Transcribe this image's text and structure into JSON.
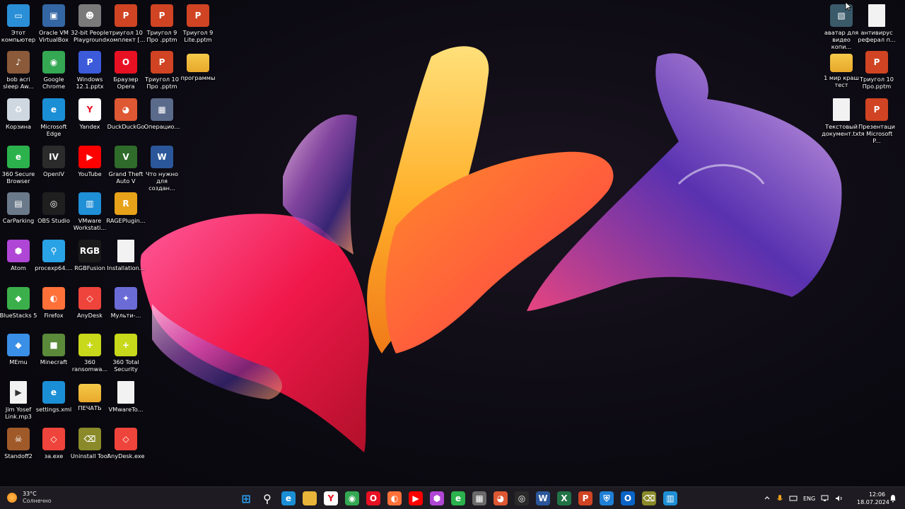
{
  "desktop": {
    "icons_left": [
      {
        "label": "Этот компьютер",
        "icon": "monitor-icon",
        "color": "#2a8fd6"
      },
      {
        "label": "Oracle VM VirtualBox",
        "icon": "virtualbox-icon",
        "color": "#3466a3"
      },
      {
        "label": "32-bit People Playground",
        "icon": "people-playground-icon",
        "color": "#7a7a7a"
      },
      {
        "label": "триугол 10 комплект [...",
        "icon": "powerpoint-file-icon",
        "color": "#d04423"
      },
      {
        "label": "Триугол 9 Про .pptm",
        "icon": "powerpoint-file-icon",
        "color": "#d04423"
      },
      {
        "label": "Триугол 9 Lite.pptm",
        "icon": "powerpoint-file-icon",
        "color": "#d04423"
      },
      {
        "label": "bob acri sleep Aw...",
        "icon": "album-cover-icon",
        "color": "#8a5a3a"
      },
      {
        "label": "Google Chrome",
        "icon": "chrome-icon",
        "color": "#34a853"
      },
      {
        "label": "Windows 12.1.pptx",
        "icon": "powerpoint-file-icon",
        "color": "#3b5bdb"
      },
      {
        "label": "Браузер Opera",
        "icon": "opera-icon",
        "color": "#e81123"
      },
      {
        "label": "Триугол 10 Про .pptm",
        "icon": "powerpoint-file-icon",
        "color": "#d04423"
      },
      {
        "label": "программы",
        "icon": "folder-icon",
        "color": "#e8b43a"
      },
      {
        "label": "Корзина",
        "icon": "recycle-bin-icon",
        "color": "#cfd8e0"
      },
      {
        "label": "Microsoft Edge",
        "icon": "edge-icon",
        "color": "#1b8fd6"
      },
      {
        "label": "Yandex",
        "icon": "yandex-icon",
        "color": "#ffffff"
      },
      {
        "label": "DuckDuckGo",
        "icon": "duckduckgo-icon",
        "color": "#de5833"
      },
      {
        "label": "Операцио...",
        "icon": "game-thumbnail-icon",
        "color": "#5a6a8a"
      },
      {
        "label": "360 Secure Browser",
        "icon": "360-browser-icon",
        "color": "#2bb24c"
      },
      {
        "label": "OpenIV",
        "icon": "openiv-icon",
        "color": "#2b2b2b"
      },
      {
        "label": "YouTube",
        "icon": "youtube-icon",
        "color": "#ff0000"
      },
      {
        "label": "Grand Theft Auto V",
        "icon": "gta-icon",
        "color": "#2f6b2a"
      },
      {
        "label": "Что нужно для создан...",
        "icon": "word-file-icon",
        "color": "#2b579a"
      },
      {
        "label": "CarParking",
        "icon": "carparking-icon",
        "color": "#6b7a8a"
      },
      {
        "label": "OBS Studio",
        "icon": "obs-icon",
        "color": "#1f1f1f"
      },
      {
        "label": "VMware Workstati...",
        "icon": "vmware-icon",
        "color": "#1f8fd6"
      },
      {
        "label": "RAGEPlugin...",
        "icon": "rage-icon",
        "color": "#e8a21a"
      },
      {
        "label": "Atom",
        "icon": "atom-icon",
        "color": "#b046d6"
      },
      {
        "label": "procexp64....",
        "icon": "process-explorer-icon",
        "color": "#2aa2e6"
      },
      {
        "label": "RGBFusion",
        "icon": "rgbfusion-icon",
        "color": "#1a1a1a"
      },
      {
        "label": "Installation...",
        "icon": "text-file-icon",
        "color": "#e6e6e6"
      },
      {
        "label": "BlueStacks 5",
        "icon": "bluestacks-icon",
        "color": "#3bb04a"
      },
      {
        "label": "Firefox",
        "icon": "firefox-icon",
        "color": "#ff7139"
      },
      {
        "label": "AnyDesk",
        "icon": "anydesk-icon",
        "color": "#ef443b"
      },
      {
        "label": "Мульти-...",
        "icon": "multi-app-icon",
        "color": "#6b6bd6"
      },
      {
        "label": "MEmu",
        "icon": "memu-icon",
        "color": "#3a8fe6"
      },
      {
        "label": "Minecraft",
        "icon": "minecraft-icon",
        "color": "#5a8a3a"
      },
      {
        "label": "360 ransomwa...",
        "icon": "360-ransomware-icon",
        "color": "#c8d81a"
      },
      {
        "label": "360 Total Security",
        "icon": "360-total-security-icon",
        "color": "#c8d81a"
      },
      {
        "label": "Jim Yosef Link.mp3",
        "icon": "audio-file-icon",
        "color": "#e6e6e6"
      },
      {
        "label": "settings.xml",
        "icon": "edge-file-icon",
        "color": "#1b8fd6"
      },
      {
        "label": "ПЕЧАТЬ",
        "icon": "folder-icon",
        "color": "#e8b43a"
      },
      {
        "label": "VMwareTo...",
        "icon": "text-file-icon",
        "color": "#e6e6e6"
      },
      {
        "label": "Standoff2",
        "icon": "standoff-icon",
        "color": "#a05a2a"
      },
      {
        "label": "за.exe",
        "icon": "anydesk-icon",
        "color": "#ef443b"
      },
      {
        "label": "Uninstall Tool",
        "icon": "uninstall-tool-icon",
        "color": "#8a8a2a"
      },
      {
        "label": "AnyDesk.exe",
        "icon": "anydesk-icon",
        "color": "#ef443b"
      }
    ],
    "icons_right": [
      {
        "label": "аватар для видео копи...",
        "icon": "image-thumbnail-icon",
        "color": "#3a5a6a"
      },
      {
        "label": "антивирус реферал п...",
        "icon": "text-file-icon",
        "color": "#e6e6e6"
      },
      {
        "label": "1 мир краш тест",
        "icon": "folder-icon",
        "color": "#e8b43a"
      },
      {
        "label": "Триугол 10 Про.pptm",
        "icon": "powerpoint-file-icon",
        "color": "#d04423"
      },
      {
        "label": "Текстовый документ.txt",
        "icon": "text-file-icon",
        "color": "#e6e6e6"
      },
      {
        "label": "Презентация Microsoft P...",
        "icon": "powerpoint-file-icon",
        "color": "#d04423"
      }
    ]
  },
  "taskbar": {
    "weather": {
      "temperature": "33°C",
      "condition": "Солнечно"
    },
    "pinned": [
      {
        "name": "start-button",
        "icon": "windows-start-icon",
        "color": "#2a9ff0"
      },
      {
        "name": "search-button",
        "icon": "search-icon",
        "color": "#ffffff"
      },
      {
        "name": "edge-taskbar",
        "icon": "edge-icon",
        "color": "#1b8fd6"
      },
      {
        "name": "explorer-taskbar",
        "icon": "folder-icon",
        "color": "#e8b43a"
      },
      {
        "name": "yandex-taskbar",
        "icon": "yandex-icon",
        "color": "#ffffff"
      },
      {
        "name": "chrome-taskbar",
        "icon": "chrome-icon",
        "color": "#34a853"
      },
      {
        "name": "opera-taskbar",
        "icon": "opera-icon",
        "color": "#e81123"
      },
      {
        "name": "firefox-taskbar",
        "icon": "firefox-icon",
        "color": "#ff7139"
      },
      {
        "name": "youtube-taskbar",
        "icon": "youtube-icon",
        "color": "#ff0000"
      },
      {
        "name": "atom-taskbar",
        "icon": "atom-icon",
        "color": "#b046d6"
      },
      {
        "name": "360-taskbar",
        "icon": "360-browser-icon",
        "color": "#2bb24c"
      },
      {
        "name": "calculator-taskbar",
        "icon": "calculator-icon",
        "color": "#6a6a6a"
      },
      {
        "name": "duckduckgo-taskbar",
        "icon": "duckduckgo-icon",
        "color": "#de5833"
      },
      {
        "name": "obs-taskbar",
        "icon": "obs-icon",
        "color": "#2a2a2a"
      },
      {
        "name": "word-taskbar",
        "icon": "word-icon",
        "color": "#2b579a"
      },
      {
        "name": "excel-taskbar",
        "icon": "excel-icon",
        "color": "#217346"
      },
      {
        "name": "powerpoint-taskbar",
        "icon": "powerpoint-icon",
        "color": "#d04423"
      },
      {
        "name": "defender-taskbar",
        "icon": "shield-icon",
        "color": "#1f7fd6"
      },
      {
        "name": "outlook-taskbar",
        "icon": "outlook-icon",
        "color": "#0a64c8"
      },
      {
        "name": "uninstall-taskbar",
        "icon": "uninstall-tool-icon",
        "color": "#8a8a2a"
      },
      {
        "name": "vmware-taskbar",
        "icon": "vmware-icon",
        "color": "#1f8fd6"
      }
    ],
    "tray": {
      "language": "ENG"
    },
    "clock": {
      "time": "12:06",
      "date": "18.07.2024"
    }
  }
}
